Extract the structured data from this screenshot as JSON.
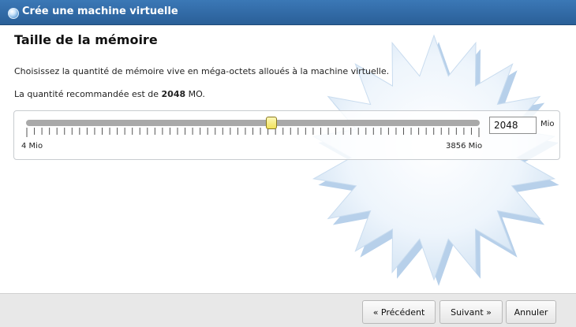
{
  "window": {
    "title": "Crée une machine virtuelle",
    "title_icon": "virtualbox-orb-icon"
  },
  "page": {
    "heading": "Taille de la mémoire",
    "description": "Choisissez la quantité de mémoire vive en méga-octets alloués à la machine virtuelle.",
    "recommended_prefix": "La quantité recommandée est de ",
    "recommended_value": "2048",
    "recommended_suffix": " MO."
  },
  "memory": {
    "value": "2048",
    "unit": "Mio",
    "min_label": "4 Mio",
    "max_label": "3856 Mio",
    "slider_min": 4,
    "slider_max": 3856,
    "slider_value": 2048
  },
  "buttons": {
    "previous": "« Précédent",
    "next": "Suivant »",
    "cancel": "Annuler"
  },
  "colors": {
    "titlebar": "#2f6aa8",
    "slider_thumb": "#f7ea7a",
    "footer": "#e8e8e8"
  }
}
